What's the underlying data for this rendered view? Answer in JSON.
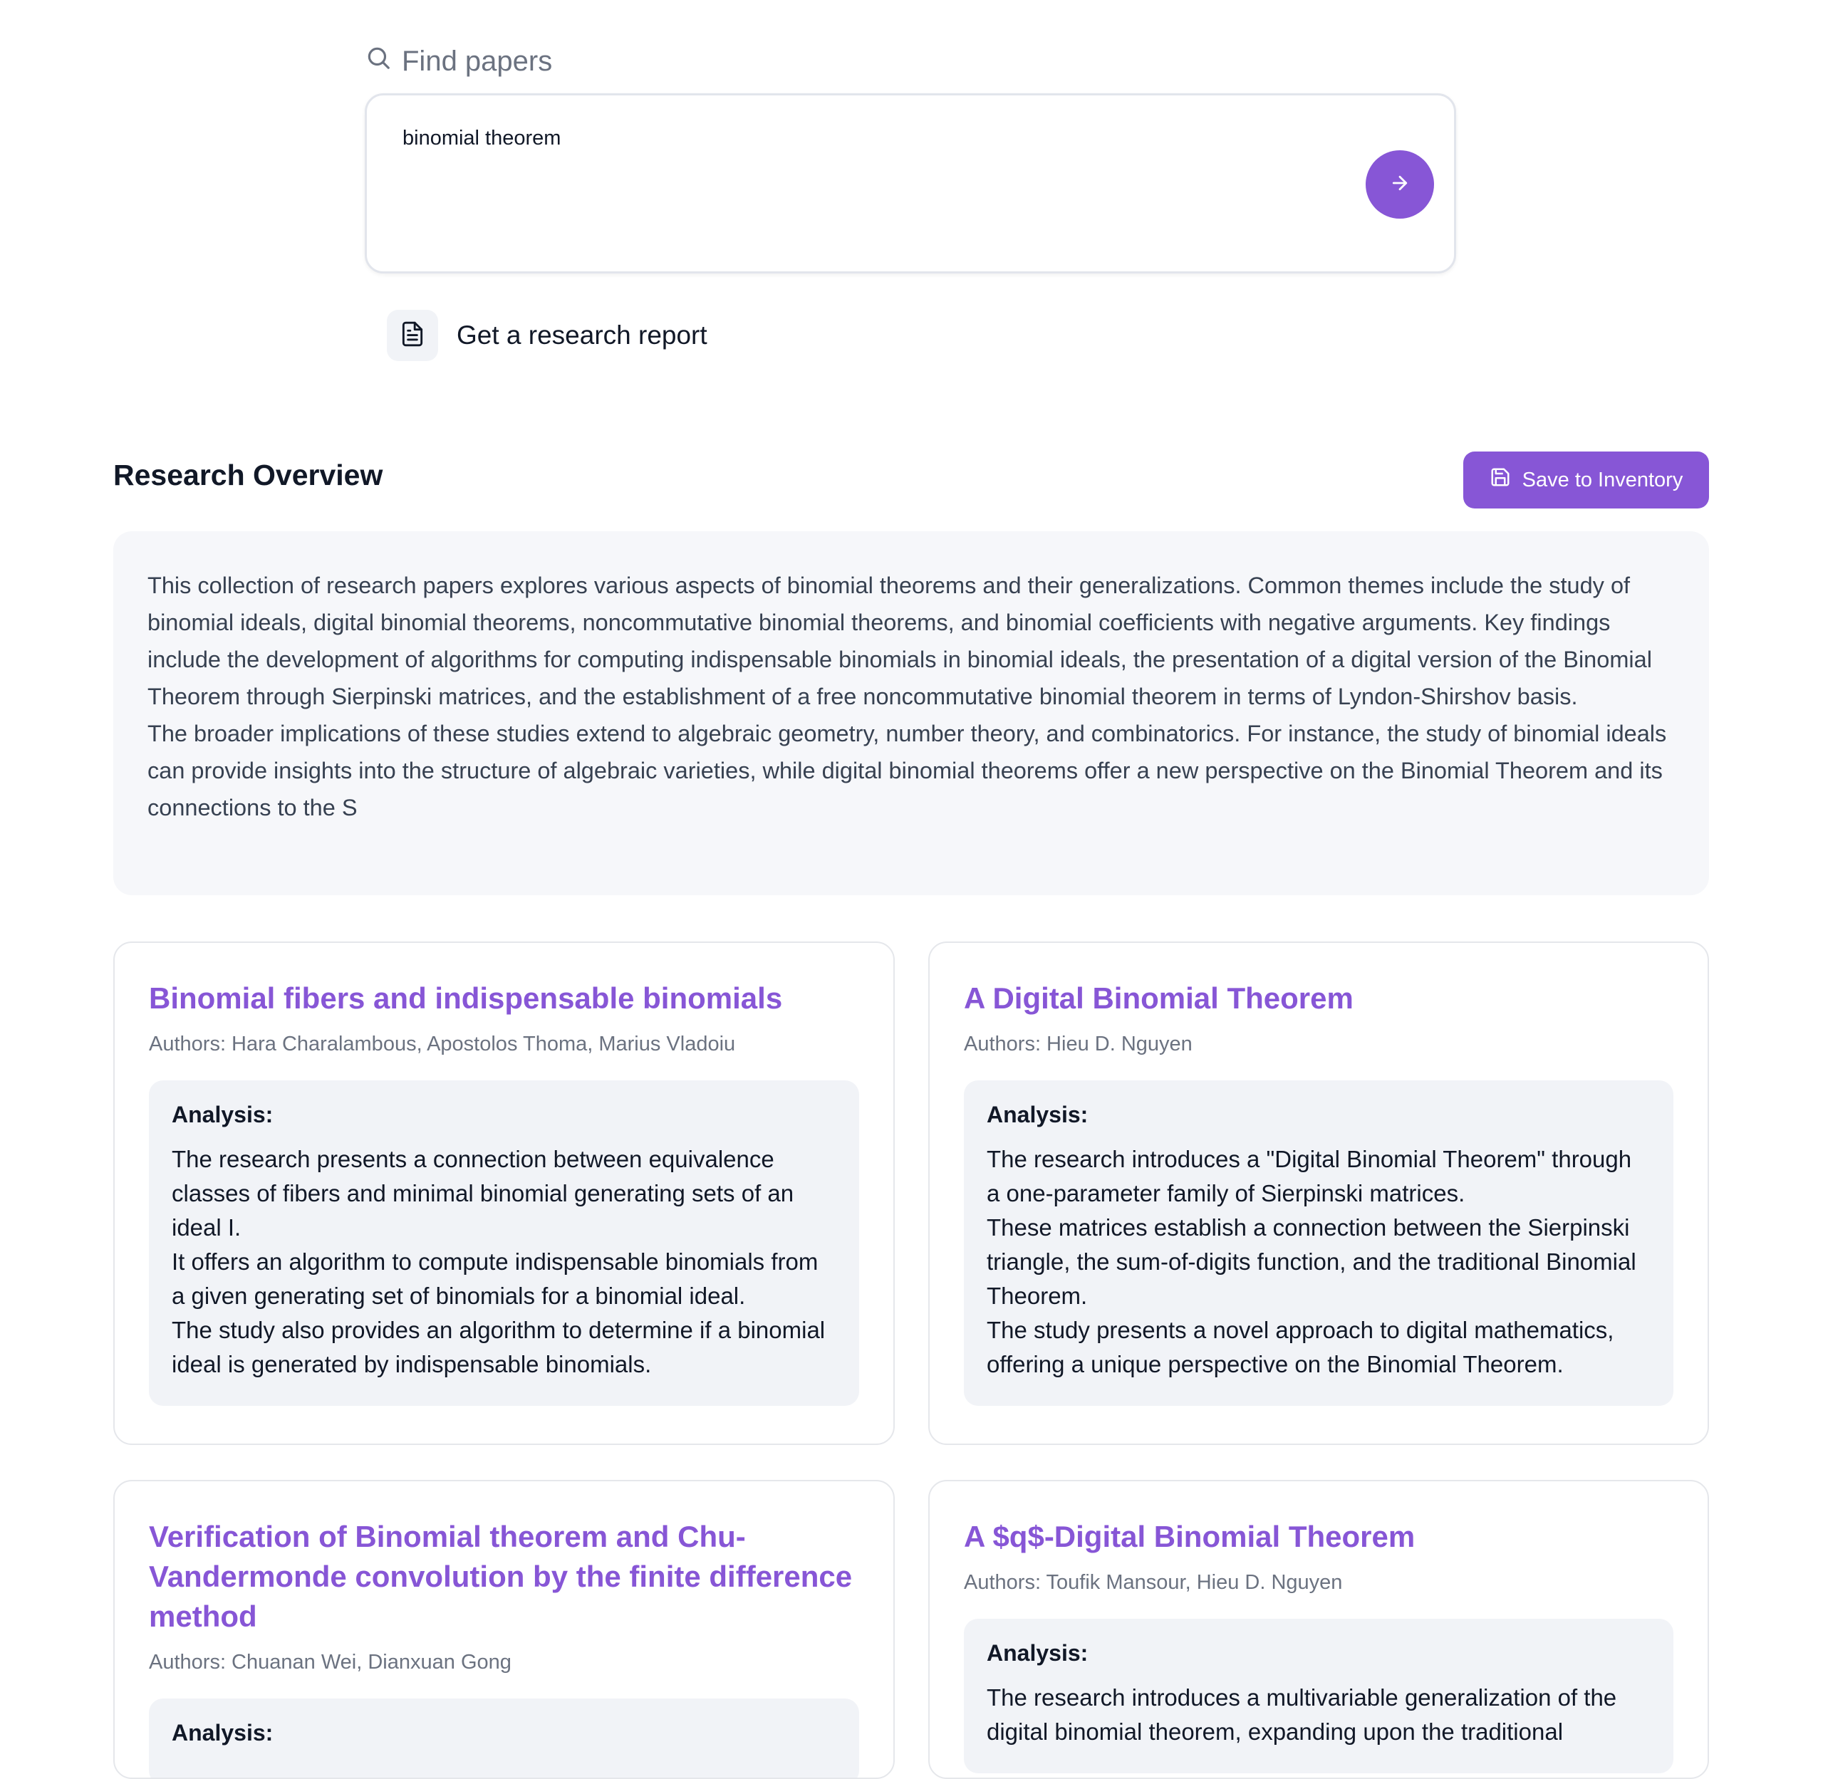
{
  "search": {
    "label": "Find papers",
    "query": "binomial theorem",
    "submit_icon": "arrow-right-icon"
  },
  "report": {
    "label": "Get a research report",
    "icon": "document-icon"
  },
  "overview": {
    "title": "Research Overview",
    "save_label": "Save to Inventory",
    "save_icon": "save-icon",
    "paragraphs": [
      "This collection of research papers explores various aspects of binomial theorems and their generalizations. Common themes include the study of binomial ideals, digital binomial theorems, noncommutative binomial theorems, and binomial coefficients with negative arguments. Key findings include the development of algorithms for computing indispensable binomials in binomial ideals, the presentation of a digital version of the Binomial Theorem through Sierpinski matrices, and the establishment of a free noncommutative binomial theorem in terms of Lyndon-Shirshov basis.",
      "The broader implications of these studies extend to algebraic geometry, number theory, and combinatorics. For instance, the study of binomial ideals can provide insights into the structure of algebraic varieties, while digital binomial theorems offer a new perspective on the Binomial Theorem and its connections to the S"
    ]
  },
  "analysis_label": "Analysis:",
  "papers": [
    {
      "title": "Binomial fibers and indispensable binomials",
      "authors": "Authors: Hara Charalambous, Apostolos Thoma, Marius Vladoiu",
      "analysis": [
        "The research presents a connection between equivalence classes of fibers and minimal binomial generating sets of an ideal I.",
        "It offers an algorithm to compute indispensable binomials from a given generating set of binomials for a binomial ideal.",
        "The study also provides an algorithm to determine if a binomial ideal is generated by indispensable binomials."
      ]
    },
    {
      "title": "A Digital Binomial Theorem",
      "authors": "Authors: Hieu D. Nguyen",
      "analysis": [
        "The research introduces a \"Digital Binomial Theorem\" through a one-parameter family of Sierpinski matrices.",
        "These matrices establish a connection between the Sierpinski triangle, the sum-of-digits function, and the traditional Binomial Theorem.",
        "The study presents a novel approach to digital mathematics, offering a unique perspective on the Binomial Theorem."
      ]
    },
    {
      "title": "Verification of Binomial theorem and Chu-Vandermonde convolution by the finite difference method",
      "authors": "Authors: Chuanan Wei, Dianxuan Gong",
      "analysis": []
    },
    {
      "title": "A $q$-Digital Binomial Theorem",
      "authors": "Authors: Toufik Mansour, Hieu D. Nguyen",
      "analysis": [
        "The research introduces a multivariable generalization of the digital binomial theorem, expanding upon the traditional"
      ]
    }
  ]
}
